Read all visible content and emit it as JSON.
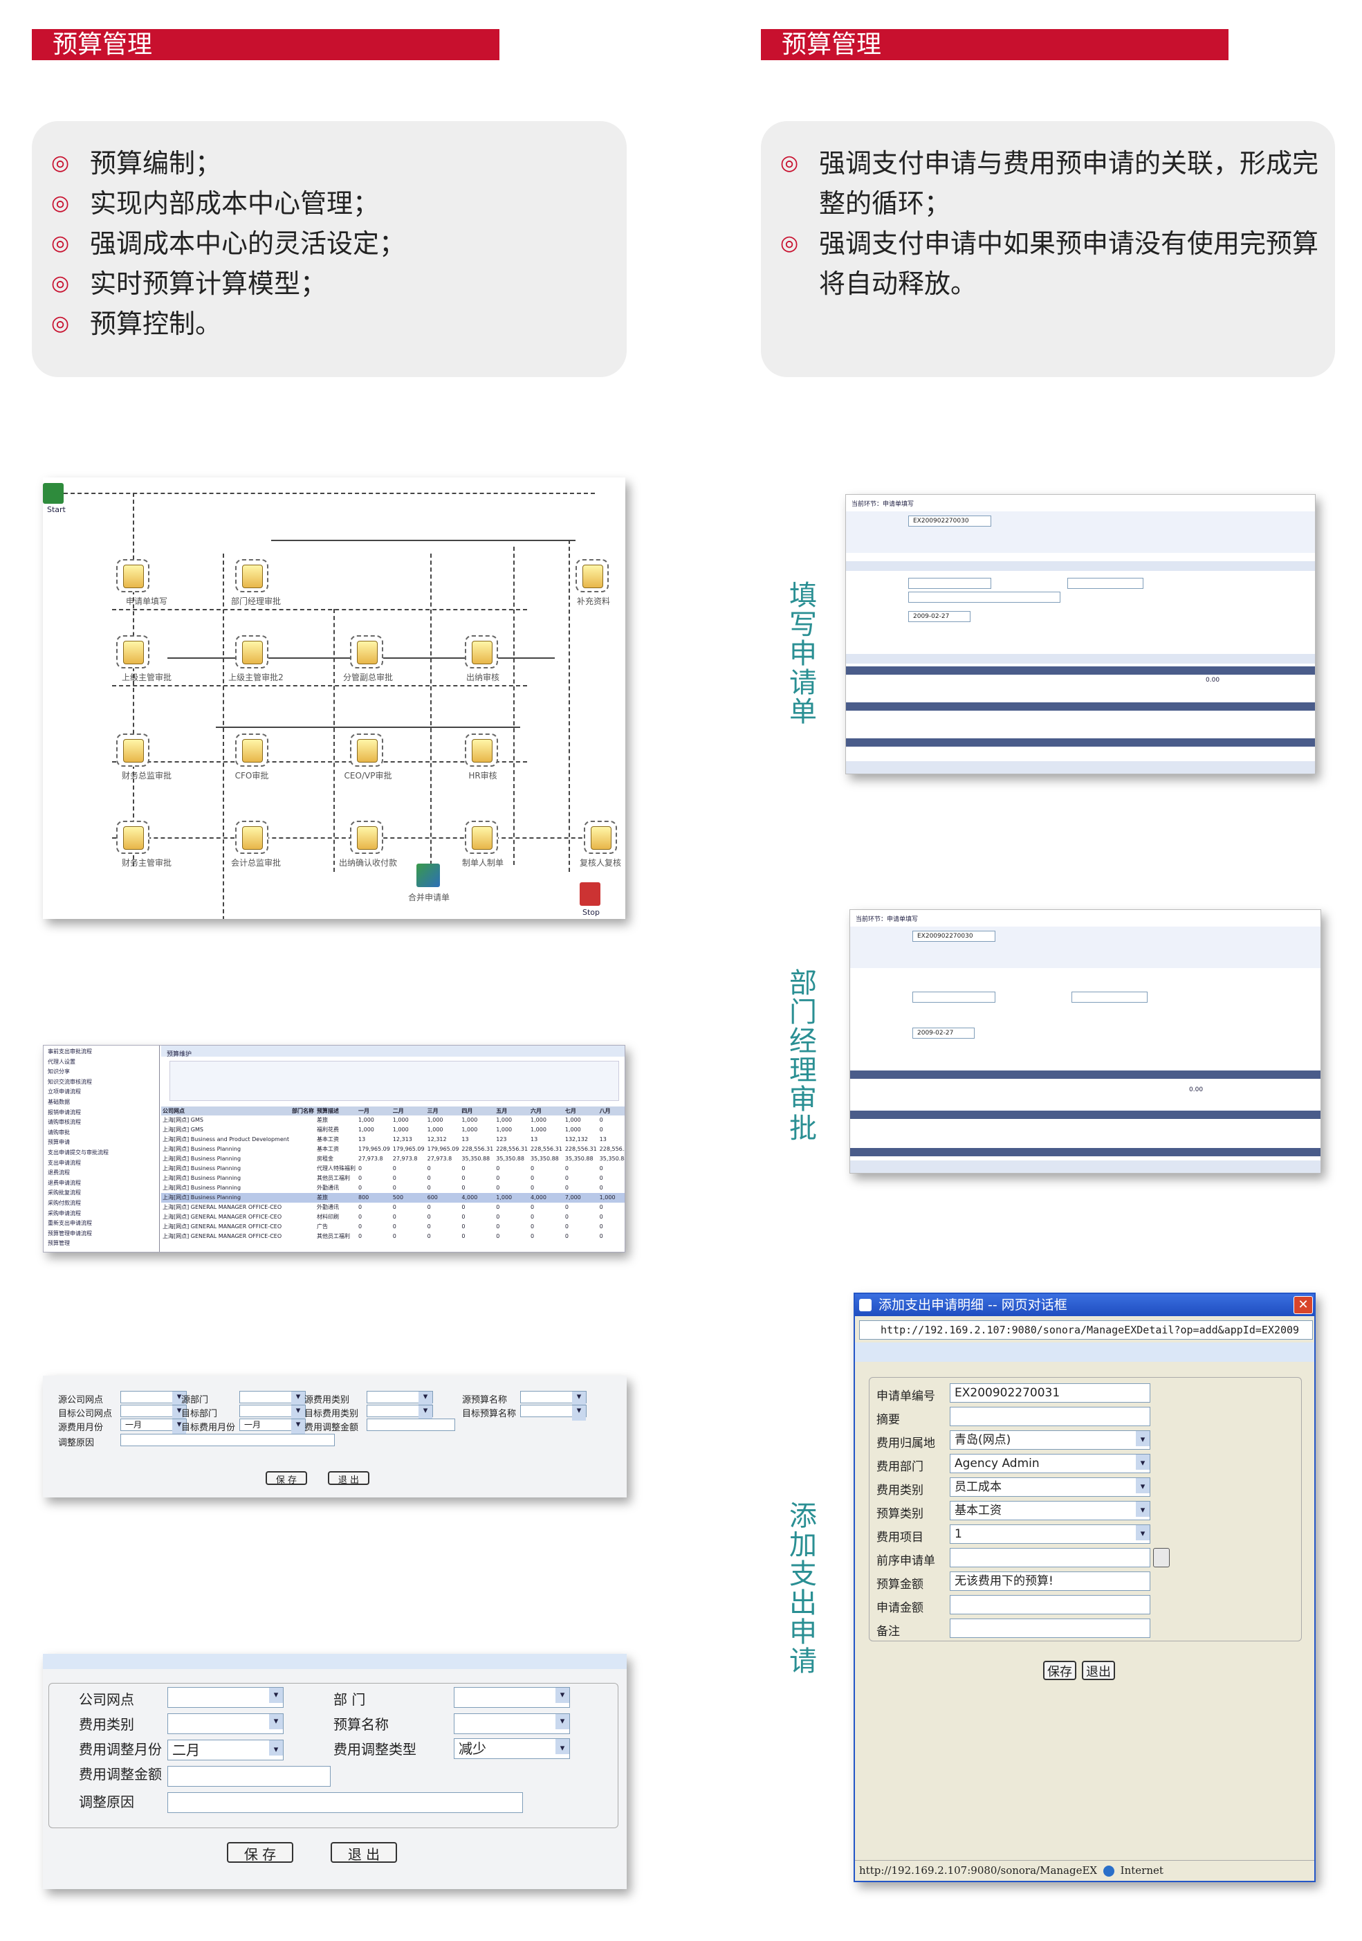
{
  "left_header": "预算管理",
  "right_header": "预算管理",
  "left_bullets": [
    "预算编制；",
    "实现内部成本中心管理；",
    "强调成本中心的灵活设定；",
    "实时预算计算模型；",
    "预算控制。"
  ],
  "right_bullets": [
    "强调支付申请与费用预申请的关联，形成完整的循环；",
    "强调支付申请中如果预申请没有使用完预算将自动释放。"
  ],
  "bullet_mark": "◎",
  "side_labels": {
    "fill": "填写申请单",
    "approve": "部门经理审批",
    "add": "添加支出申请"
  },
  "workflow": {
    "start": "Start",
    "stop": "Stop",
    "nodes": [
      "申请单填写",
      "部门经理审批",
      "补充资料",
      "上级主管审批",
      "上级主管审批2",
      "分管副总审批",
      "出纳审核",
      "财务总监审批",
      "CFO审批",
      "CEO/VP审批",
      "HR审核",
      "财务主管审批",
      "会计总监审批",
      "出纳确认收付款",
      "制单人制单",
      "复核人复核",
      "合并申请单"
    ]
  },
  "form1": {
    "title": "当前环节：申请单填写",
    "doc_no": "EX200902270030",
    "date": "2009-02-27",
    "total": "0.00"
  },
  "form2": {
    "title": "当前环节：申请单填写",
    "doc_no": "EX200902270030",
    "date": "2009-02-27",
    "total": "0.00"
  },
  "budget_table": {
    "title": "预算维护",
    "tree": [
      "事前支出审批流程",
      "代理人设置",
      "知识分享",
      "知识交流审核流程",
      "立项申请流程",
      "基础数据",
      "报销申请流程",
      "请购审核流程",
      "请购审批",
      "预算申请",
      "支出申请提交与审批流程",
      "支出申请流程",
      "退费流程",
      "退费申请流程",
      "采购批复流程",
      "采购付款流程",
      "采购申请流程",
      "重新支出申请流程",
      "预算管理申请流程",
      "预算管理"
    ],
    "headers": [
      "公司网点",
      "部门名称",
      "预算描述",
      "一月",
      "二月",
      "三月",
      "四月",
      "五月",
      "六月",
      "七月",
      "八月"
    ],
    "rows": [
      [
        "上海[网点] GMS",
        "",
        "差旅",
        "1,000",
        "1,000",
        "1,000",
        "1,000",
        "1,000",
        "1,000",
        "1,000",
        "0"
      ],
      [
        "上海[网点] GMS",
        "",
        "福利花费",
        "1,000",
        "1,000",
        "1,000",
        "1,000",
        "1,000",
        "1,000",
        "1,000",
        "0"
      ],
      [
        "上海[网点] Business and Product Development",
        "",
        "基本工资",
        "13",
        "12,313",
        "12,312",
        "13",
        "123",
        "13",
        "132,132",
        "13"
      ],
      [
        "上海[网点] Business Planning",
        "",
        "基本工资",
        "179,965.09",
        "179,965.09",
        "179,965.09",
        "228,556.31",
        "228,556.31",
        "228,556.31",
        "228,556.31",
        "228,556.31"
      ],
      [
        "上海[网点] Business Planning",
        "",
        "房租金",
        "27,973.8",
        "27,973.8",
        "27,973.8",
        "35,350.88",
        "35,350.88",
        "35,350.88",
        "35,350.88",
        "35,350.88"
      ],
      [
        "上海[网点] Business Planning",
        "",
        "代理人特殊福利",
        "0",
        "0",
        "0",
        "0",
        "0",
        "0",
        "0",
        "0"
      ],
      [
        "上海[网点] Business Planning",
        "",
        "其他员工福利",
        "0",
        "0",
        "0",
        "0",
        "0",
        "0",
        "0",
        "0"
      ],
      [
        "上海[网点] Business Planning",
        "",
        "外勤通讯",
        "0",
        "0",
        "0",
        "0",
        "0",
        "0",
        "0",
        "0"
      ],
      [
        "上海[网点] Business Planning",
        "",
        "差旅",
        "800",
        "500",
        "600",
        "4,000",
        "1,000",
        "4,000",
        "7,000",
        "1,000"
      ],
      [
        "上海[网点] GENERAL MANAGER OFFICE-CEO",
        "",
        "外勤通讯",
        "0",
        "0",
        "0",
        "0",
        "0",
        "0",
        "0",
        "0"
      ],
      [
        "上海[网点] GENERAL MANAGER OFFICE-CEO",
        "",
        "材料印刷",
        "0",
        "0",
        "0",
        "0",
        "0",
        "0",
        "0",
        "0"
      ],
      [
        "上海[网点] GENERAL MANAGER OFFICE-CEO",
        "",
        "广告",
        "0",
        "0",
        "0",
        "0",
        "0",
        "0",
        "0",
        "0"
      ],
      [
        "上海[网点] GENERAL MANAGER OFFICE-CEO",
        "",
        "其他员工福利",
        "0",
        "0",
        "0",
        "0",
        "0",
        "0",
        "0",
        "0"
      ]
    ]
  },
  "transfer_form": {
    "labels": [
      "源公司网点",
      "源部门",
      "源费用类别",
      "源预算名称",
      "目标公司网点",
      "目标部门",
      "目标费用类别",
      "目标预算名称",
      "源费用月份",
      "目标费用月份",
      "费用调整金额",
      "调整原因"
    ],
    "src_month": "一月",
    "dst_month": "一月",
    "save": "保 存",
    "exit": "退 出"
  },
  "adjust_form": {
    "labels": [
      "公司网点",
      "部 门",
      "费用类别",
      "预算名称",
      "费用调整月份",
      "费用调整类型",
      "费用调整金额",
      "调整原因"
    ],
    "month": "二月",
    "type": "减少",
    "save": "保 存",
    "exit": "退 出"
  },
  "dialog": {
    "title": "添加支出申请明细 -- 网页对话框",
    "url": "http://192.169.2.107:9080/sonora/ManageEXDetail?op=add&appId=EX2009",
    "status_url": "http://192.169.2.107:9080/sonora/ManageEX",
    "zone": "Internet",
    "fields": [
      {
        "label": "申请单编号",
        "value": "EX200902270031"
      },
      {
        "label": "摘要",
        "value": ""
      },
      {
        "label": "费用归属地",
        "value": "青岛(网点)"
      },
      {
        "label": "费用部门",
        "value": "Agency Admin"
      },
      {
        "label": "费用类别",
        "value": "员工成本"
      },
      {
        "label": "预算类别",
        "value": "基本工资"
      },
      {
        "label": "费用项目",
        "value": "1"
      },
      {
        "label": "前序申请单",
        "value": ""
      },
      {
        "label": "预算金额",
        "value": "无该费用下的预算!"
      },
      {
        "label": "申请金额",
        "value": ""
      },
      {
        "label": "备注",
        "value": ""
      }
    ],
    "save": "保存",
    "exit": "退出"
  },
  "colors": {
    "accent": "#c8102e",
    "teal": "#2a8f93",
    "box_bg": "#eeeeee"
  }
}
